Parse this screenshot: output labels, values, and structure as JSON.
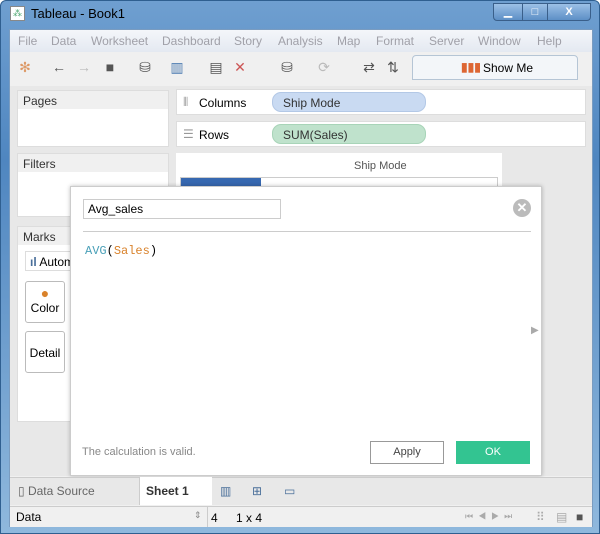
{
  "window": {
    "title": "Tableau - Book1",
    "minimize": "▁",
    "maximize": "□",
    "close": "X"
  },
  "menu": [
    "File",
    "Data",
    "Worksheet",
    "Dashboard",
    "Story",
    "Analysis",
    "Map",
    "Format",
    "Server",
    "Window",
    "Help"
  ],
  "toolbar": {
    "show_me": "Show Me"
  },
  "panels": {
    "pages": "Pages",
    "filters": "Filters",
    "marks": "Marks",
    "mark_type": "Automatic",
    "color": "Color",
    "detail": "Detail"
  },
  "shelves": {
    "columns_label": "Columns",
    "columns_pill": "Ship Mode",
    "rows_label": "Rows",
    "rows_pill": "SUM(Sales)"
  },
  "view": {
    "header": "Ship Mode"
  },
  "dialog": {
    "name": "Avg_sales",
    "formula_func": "AVG",
    "formula_open": "(",
    "formula_field": "Sales",
    "formula_close": ")",
    "status": "The calculation is valid.",
    "apply": "Apply",
    "ok": "OK"
  },
  "tabs": {
    "data_source": "Data Source",
    "sheet": "Sheet 1"
  },
  "status": {
    "data_source": "Data",
    "marks": "4",
    "dims": "1 x 4"
  },
  "colors": {
    "pill_dim": "#c9daf2",
    "pill_measure": "#bfe2cc",
    "ok": "#33c491",
    "func": "#4aa0b8",
    "field": "#d9822b"
  }
}
